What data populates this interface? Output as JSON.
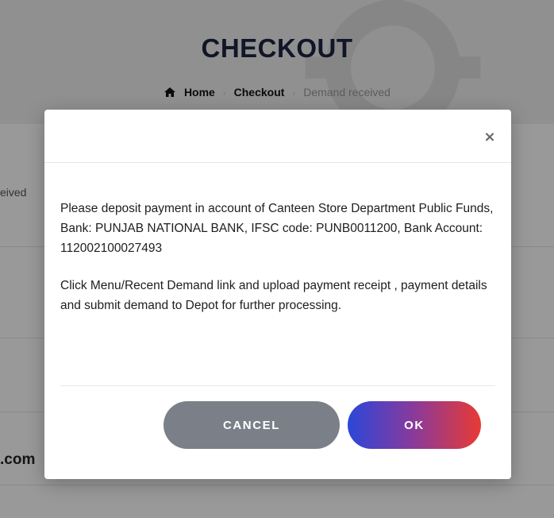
{
  "page": {
    "title": "CHECKOUT",
    "breadcrumb": {
      "home": "Home",
      "checkout": "Checkout",
      "current": "Demand received"
    },
    "background": {
      "partial_received": "eived",
      "partial_email": ".com"
    }
  },
  "modal": {
    "close_symbol": "×",
    "paragraph1": "Please deposit payment in account of Canteen Store Department Public Funds, Bank: PUNJAB NATIONAL BANK, IFSC code: PUNB0011200, Bank Account: 112002100027493",
    "paragraph2": "Click Menu/Recent Demand link and upload payment receipt , payment details and submit demand to Depot for further processing.",
    "cancel_label": "CANCEL",
    "ok_label": "OK"
  },
  "colors": {
    "title": "#1c2541",
    "cancel_button": "#7b8088",
    "ok_gradient_start": "#2b47d8",
    "ok_gradient_end": "#e83a34"
  },
  "icons": {
    "home": "home-icon",
    "close": "close-icon"
  }
}
